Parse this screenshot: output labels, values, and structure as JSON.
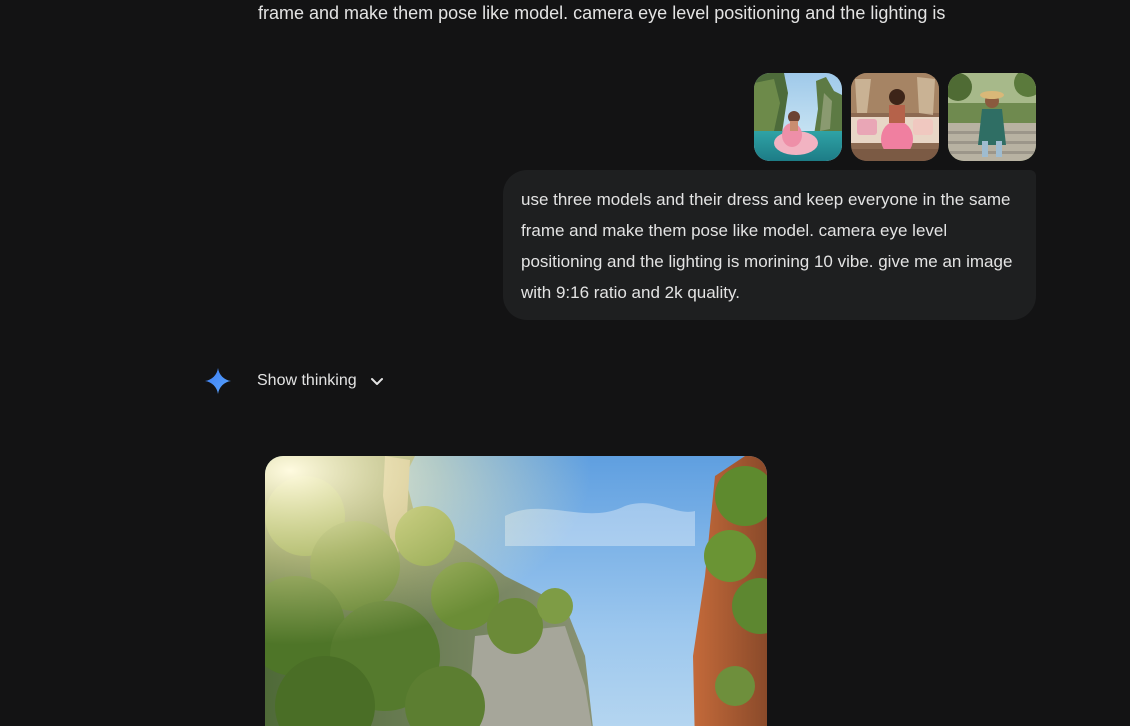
{
  "previous_message": {
    "text": "frame and make them pose like model. camera eye level positioning and the lighting is"
  },
  "user_message": {
    "text": "use three models and their dress and keep everyone in the same frame and make them pose like model. camera eye level positioning and the lighting is morining 10 vibe. give me an image with 9:16 ratio and 2k quality.",
    "attachments": [
      "image-thumbnail-1",
      "image-thumbnail-2",
      "image-thumbnail-3"
    ]
  },
  "response": {
    "icon": "gemini-spark-icon",
    "show_thinking_label": "Show thinking",
    "chevron_icon": "chevron-down-icon"
  },
  "colors": {
    "background": "#131314",
    "bubble": "#1e1f20",
    "text": "#e3e3e3",
    "accent": "#4a90f5"
  }
}
